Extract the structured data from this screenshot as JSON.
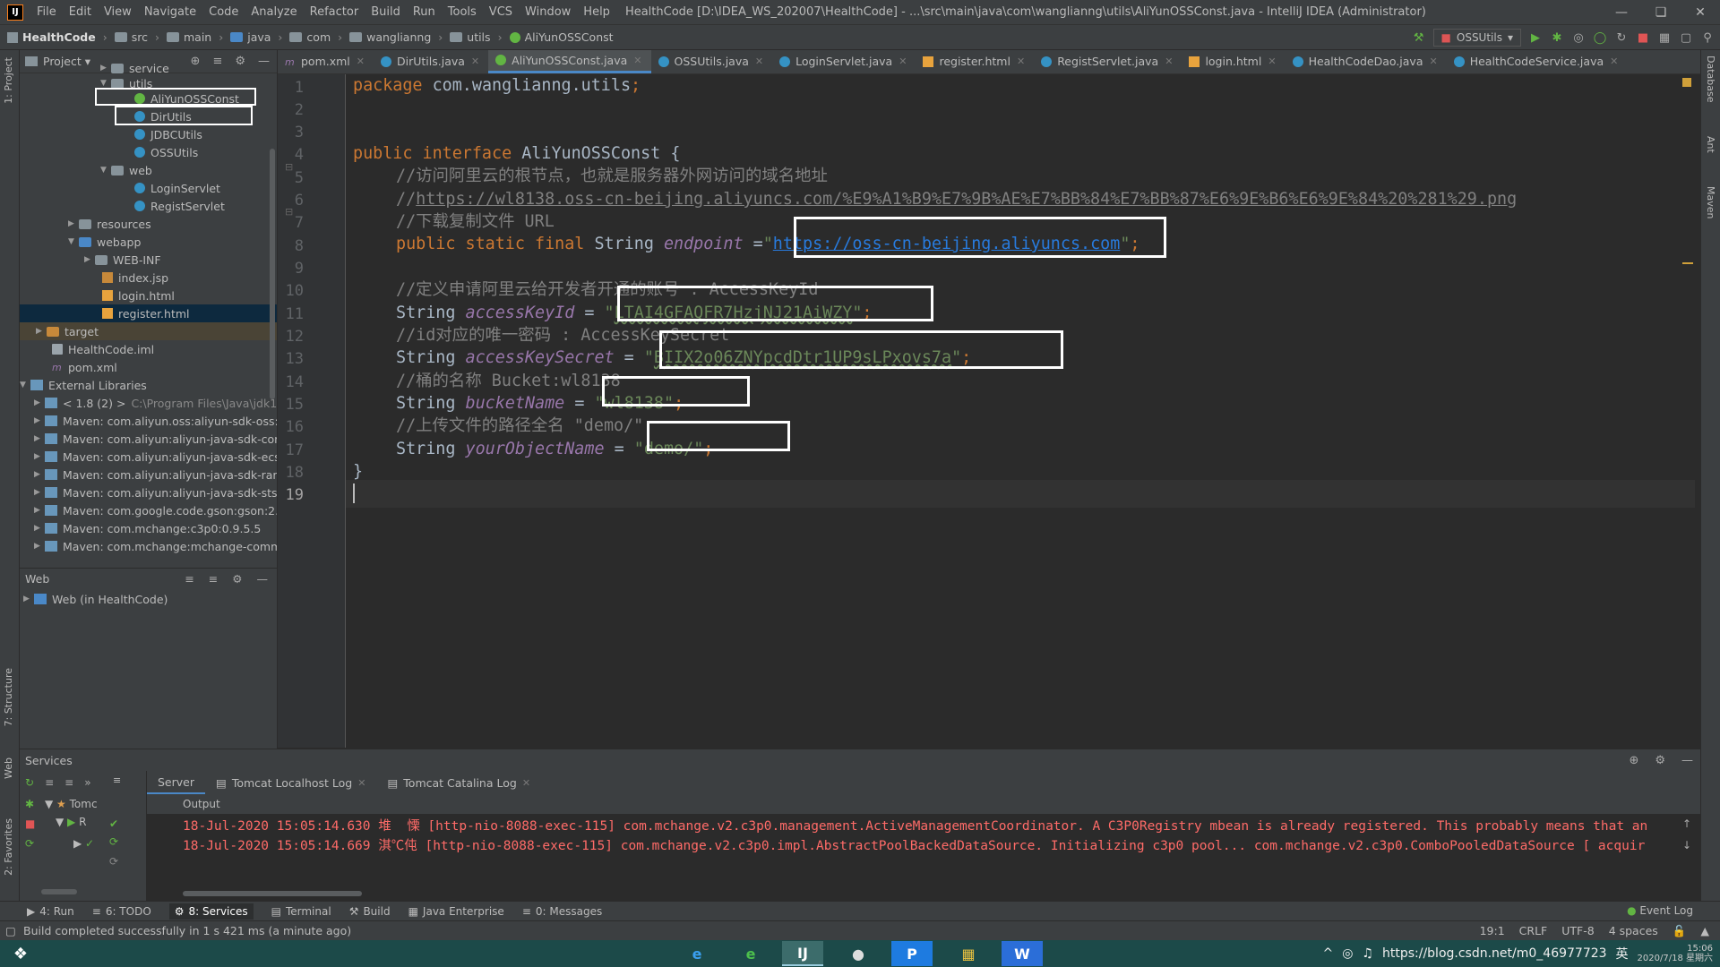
{
  "app": {
    "icon_label": "IJ",
    "menu": [
      "File",
      "Edit",
      "View",
      "Navigate",
      "Code",
      "Analyze",
      "Refactor",
      "Build",
      "Run",
      "Tools",
      "VCS",
      "Window",
      "Help"
    ],
    "window_title": "HealthCode [D:\\IDEA_WS_202007\\HealthCode] - ...\\src\\main\\java\\com\\wanglianng\\utils\\AliYunOSSConst.java - IntelliJ IDEA (Administrator)"
  },
  "breadcrumb": [
    "HealthCode",
    "src",
    "main",
    "java",
    "com",
    "wanglianng",
    "utils",
    "AliYunOSSConst"
  ],
  "run_config": "OSSUtils",
  "project_panel": {
    "title": "Project",
    "tree": [
      {
        "label": "service",
        "type": "folder",
        "expanded": false
      },
      {
        "label": "utils",
        "type": "folder",
        "expanded": true
      },
      {
        "label": "AliYunOSSConst",
        "type": "interface"
      },
      {
        "label": "DirUtils",
        "type": "class"
      },
      {
        "label": "JDBCUtils",
        "type": "class"
      },
      {
        "label": "OSSUtils",
        "type": "class"
      },
      {
        "label": "web",
        "type": "folder",
        "expanded": true
      },
      {
        "label": "LoginServlet",
        "type": "class"
      },
      {
        "label": "RegistServlet",
        "type": "class"
      },
      {
        "label": "resources",
        "type": "folder",
        "expanded": false
      },
      {
        "label": "webapp",
        "type": "folder",
        "expanded": true
      },
      {
        "label": "WEB-INF",
        "type": "folder",
        "expanded": false
      },
      {
        "label": "index.jsp",
        "type": "jsp"
      },
      {
        "label": "login.html",
        "type": "html"
      },
      {
        "label": "register.html",
        "type": "html"
      },
      {
        "label": "target",
        "type": "folder-orange",
        "expanded": false
      },
      {
        "label": "HealthCode.iml",
        "type": "file"
      },
      {
        "label": "pom.xml",
        "type": "maven"
      },
      {
        "label": "External Libraries",
        "type": "lib",
        "expanded": true
      },
      {
        "label": "< 1.8 (2) >",
        "type": "lib",
        "extra": "C:\\Program Files\\Java\\jdk1.8"
      },
      {
        "label": "Maven: com.aliyun.oss:aliyun-sdk-oss:3.",
        "type": "lib"
      },
      {
        "label": "Maven: com.aliyun:aliyun-java-sdk-core:",
        "type": "lib"
      },
      {
        "label": "Maven: com.aliyun:aliyun-java-sdk-ecs:4",
        "type": "lib"
      },
      {
        "label": "Maven: com.aliyun:aliyun-java-sdk-ram:",
        "type": "lib"
      },
      {
        "label": "Maven: com.aliyun:aliyun-java-sdk-sts:3.",
        "type": "lib"
      },
      {
        "label": "Maven: com.google.code.gson:gson:2.8",
        "type": "lib"
      },
      {
        "label": "Maven: com.mchange:c3p0:0.9.5.5",
        "type": "lib"
      },
      {
        "label": "Maven: com.mchange:mchange-commo",
        "type": "lib"
      }
    ]
  },
  "web_panel": {
    "title": "Web",
    "item": "Web (in HealthCode)"
  },
  "tabs": [
    {
      "label": "pom.xml",
      "icon": "xml"
    },
    {
      "label": "DirUtils.java",
      "icon": "class"
    },
    {
      "label": "AliYunOSSConst.java",
      "icon": "interface",
      "active": true
    },
    {
      "label": "OSSUtils.java",
      "icon": "class"
    },
    {
      "label": "LoginServlet.java",
      "icon": "class"
    },
    {
      "label": "register.html",
      "icon": "html"
    },
    {
      "label": "RegistServlet.java",
      "icon": "class"
    },
    {
      "label": "login.html",
      "icon": "html"
    },
    {
      "label": "HealthCodeDao.java",
      "icon": "class"
    },
    {
      "label": "HealthCodeService.java",
      "icon": "class"
    }
  ],
  "code": {
    "line_numbers": [
      "1",
      "2",
      "3",
      "4",
      "5",
      "6",
      "7",
      "8",
      "9",
      "10",
      "11",
      "12",
      "13",
      "14",
      "15",
      "16",
      "17",
      "18",
      "19"
    ],
    "package": "com.wanglianng.utils",
    "interface_name": "AliYunOSSConst",
    "comment_root": "//访问阿里云的根节点，也就是服务器外网访问的域名地址",
    "comment_url_prefix": "//",
    "comment_url": "https://wl8138.oss-cn-beijing.aliyuncs.com/%E9%A1%B9%E7%9B%AE%E7%BB%84%E7%BB%87%E6%9E%B6%E6%9E%84%20%281%29.png",
    "comment_download": "//下载复制文件 URL",
    "endpoint_value": "https://oss-cn-beijing.aliyuncs.com",
    "comment_keyid": "//定义申请阿里云给开发者开通的账号 : AccessKeyId",
    "access_key_id": "LTAI4GFAQFR7HzjNJ21AiWZY",
    "comment_secret": "//id对应的唯一密码 : AccessKeySecret",
    "access_key_secret": "BIIX2o06ZNYpcdDtr1UP9sLPxovs7a",
    "comment_bucket": "//桶的名称 Bucket:wl8138",
    "bucket_name": "wl8138",
    "comment_path": "//上传文件的路径全名 \"demo/\"",
    "object_name": "demo/"
  },
  "services": {
    "title": "Services",
    "tree_item": "Tomc",
    "tree_sub": "R",
    "tabs": [
      "Server",
      "Tomcat Localhost Log",
      "Tomcat Catalina Log"
    ],
    "output_label": "Output",
    "logs": [
      "18-Jul-2020 15:05:14.630 堆  慄 [http-nio-8088-exec-115] com.mchange.v2.c3p0.management.ActiveManagementCoordinator. A C3P0Registry mbean is already registered. This probably means that an",
      "18-Jul-2020 15:05:14.669 淇℃伅 [http-nio-8088-exec-115] com.mchange.v2.c3p0.impl.AbstractPoolBackedDataSource. Initializing c3p0 pool... com.mchange.v2.c3p0.ComboPooledDataSource [ acquir"
    ]
  },
  "bottom_tools": [
    "4: Run",
    "6: TODO",
    "8: Services",
    "Terminal",
    "Build",
    "Java Enterprise",
    "0: Messages"
  ],
  "event_log": "Event Log",
  "status": {
    "message": "Build completed successfully in 1 s 421 ms (a minute ago)",
    "position": "19:1",
    "line_sep": "CRLF",
    "encoding": "UTF-8",
    "indent": "4 spaces"
  },
  "left_vtabs": [
    "1: Project",
    "7: Structure",
    "Web",
    "2: Favorites"
  ],
  "right_vtabs": [
    "Database",
    "Ant",
    "Maven"
  ],
  "taskbar": {
    "tray_text": "https://blog.csdn.net/m0_46977723",
    "ime": "英",
    "time": "15:06",
    "date": "2020/7/18 星期六"
  }
}
